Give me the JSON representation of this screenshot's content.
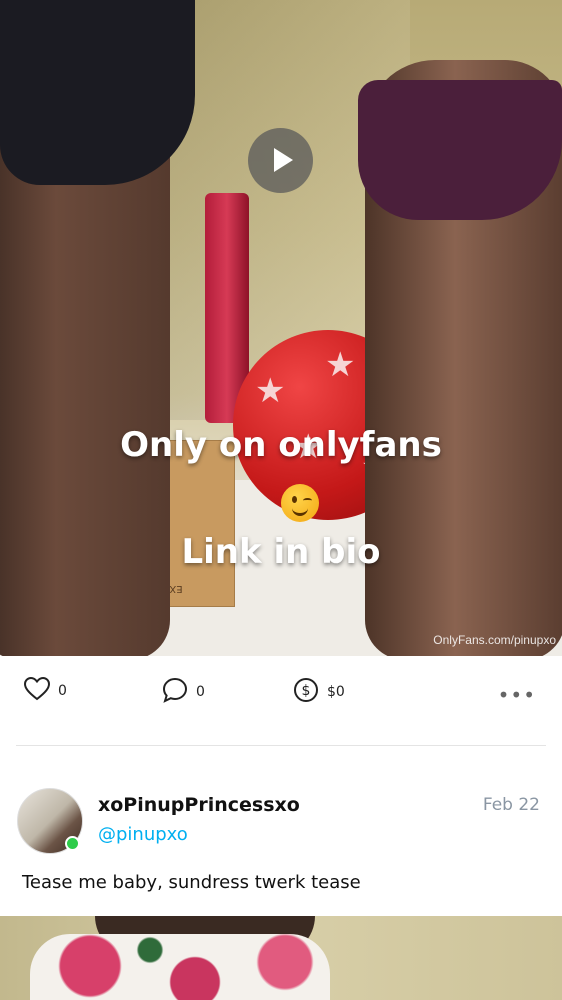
{
  "media": {
    "overlay_line1": "Only on onlyfans",
    "overlay_emoji": "winking-face",
    "overlay_line2": "Link in bio",
    "watermark": "OnlyFans.com/pinupxo",
    "box_text": "EXTRA SMALL"
  },
  "actions": {
    "likes": "0",
    "comments": "0",
    "tips": "$0",
    "more": "•••"
  },
  "post": {
    "display_name": "xoPinupPrincessxo",
    "handle": "@pinupxo",
    "date": "Feb 22",
    "caption": "Tease me baby, sundress twerk tease"
  },
  "colors": {
    "accent": "#00aff0",
    "online": "#2ecc4a",
    "muted": "#8a96a3"
  }
}
